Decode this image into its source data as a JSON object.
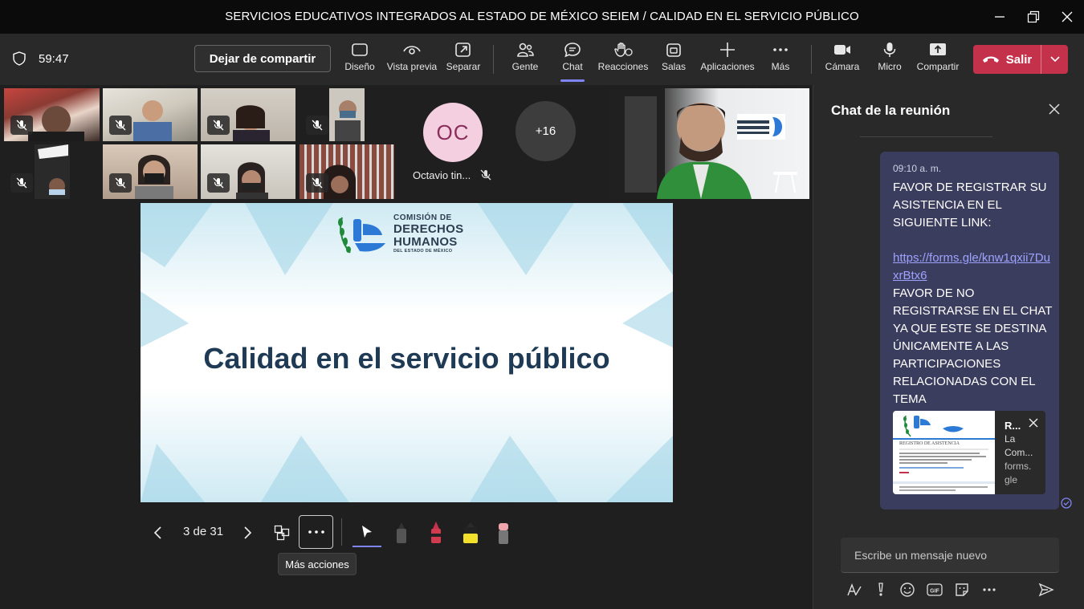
{
  "window": {
    "title": "SERVICIOS EDUCATIVOS INTEGRADOS AL ESTADO DE MÉXICO SEIEM / CALIDAD EN EL SERVICIO PÚBLICO"
  },
  "toolbar": {
    "timer": "59:47",
    "stop_sharing": "Dejar de compartir",
    "buttons": {
      "layout": "Diseño",
      "preview": "Vista previa",
      "popout": "Separar",
      "people": "Gente",
      "chat": "Chat",
      "reactions": "Reacciones",
      "rooms": "Salas",
      "apps": "Aplicaciones",
      "more": "Más",
      "camera": "Cámara",
      "mic": "Micro",
      "share": "Compartir",
      "leave": "Salir"
    }
  },
  "participants": {
    "avatar_initials": "OC",
    "avatar_name": "Octavio tin...",
    "overflow_count": "+16"
  },
  "slide": {
    "logo_line1": "COMISIÓN DE",
    "logo_line2": "DERECHOS",
    "logo_line3": "HUMANOS",
    "logo_line4": "DEL ESTADO DE MÉXICO",
    "title": "Calidad en el servicio público"
  },
  "presenter": {
    "page": "3 de 31",
    "more_actions_tooltip": "Más acciones"
  },
  "chat": {
    "title": "Chat de la reunión",
    "message": {
      "time": "09:10 a. m.",
      "text1": "FAVOR DE REGISTRAR SU ASISTENCIA EN EL SIGUIENTE LINK:",
      "link": "https://forms.gle/knw1qxii7DuxrBtx6",
      "text2": "FAVOR DE NO REGISTRARSE EN EL CHAT YA QUE ESTE SE DESTINA ÚNICAMENTE A LAS PARTICIPACIONES RELACIONADAS CON EL TEMA"
    },
    "card": {
      "title": "R...",
      "line1": "La",
      "line2": "Com...",
      "domain1": "forms.",
      "domain2": "gle",
      "thumb_heading": "REGISTRO DE ASISTENCIA"
    },
    "compose_placeholder": "Escribe un mensaje nuevo"
  },
  "colors": {
    "leave": "#c4314b",
    "accent": "#7f85f5",
    "bubble": "#3b3d5e",
    "slide_title": "#1e3a55"
  }
}
